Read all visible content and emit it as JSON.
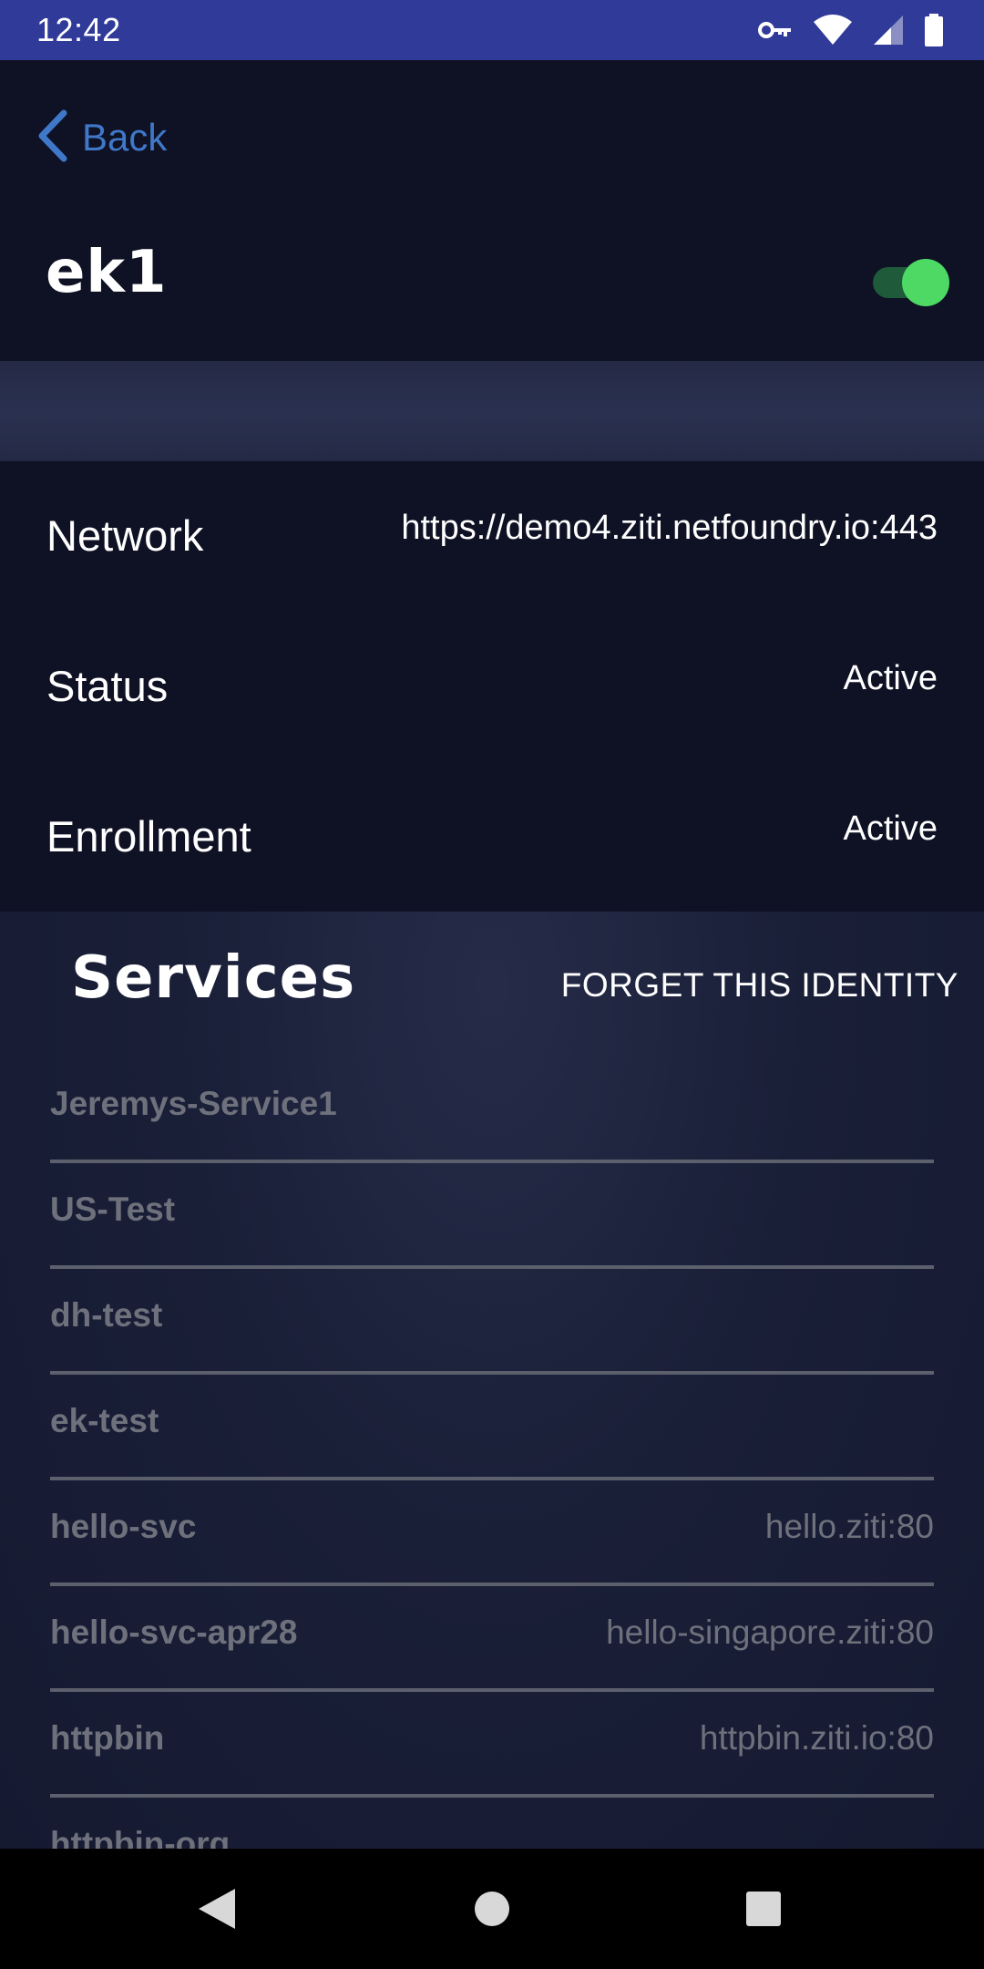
{
  "status_bar": {
    "time": "12:42",
    "icons": [
      "vpn-key-icon",
      "wifi-icon",
      "signal-icon",
      "battery-icon"
    ]
  },
  "nav": {
    "back_label": "Back"
  },
  "identity": {
    "name": "ek1",
    "enabled": true
  },
  "details": [
    {
      "label": "Network",
      "value": "https://demo4.ziti.netfoundry.io:443"
    },
    {
      "label": "Status",
      "value": "Active"
    },
    {
      "label": "Enrollment",
      "value": "Active"
    }
  ],
  "services_section": {
    "title": "Services",
    "forget_label": "FORGET THIS IDENTITY",
    "items": [
      {
        "name": "Jeremys-Service1",
        "host": ""
      },
      {
        "name": "US-Test",
        "host": ""
      },
      {
        "name": "dh-test",
        "host": ""
      },
      {
        "name": "ek-test",
        "host": ""
      },
      {
        "name": "hello-svc",
        "host": "hello.ziti:80"
      },
      {
        "name": "hello-svc-apr28",
        "host": "hello-singapore.ziti:80"
      },
      {
        "name": "httpbin",
        "host": "httpbin.ziti.io:80"
      },
      {
        "name": "httpbin-org",
        "host": ""
      }
    ]
  },
  "colors": {
    "accent_blue": "#3f78c9",
    "toggle_on": "#4dd964",
    "status_bar": "#2f3a99",
    "background": "#0f1124"
  },
  "system_nav": {
    "icons": [
      "back-triangle-icon",
      "home-circle-icon",
      "recents-square-icon"
    ]
  }
}
